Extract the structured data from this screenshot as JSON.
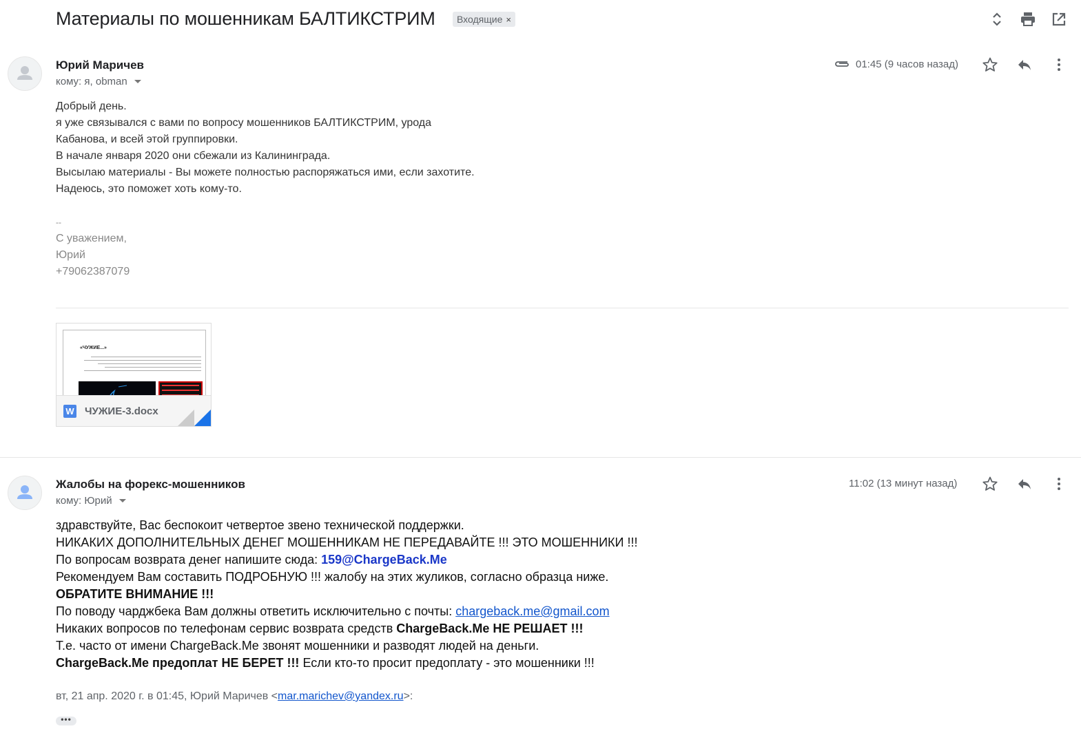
{
  "thread": {
    "subject": "Материалы по мошенникам БАЛТИКСТРИМ",
    "label": "Входящие",
    "label_close": "×"
  },
  "toolbar": {
    "expand_icon": "unfold-icon",
    "print_icon": "print-icon",
    "open_new_window_icon": "open-in-new-icon"
  },
  "message1": {
    "sender": "Юрий Маричев",
    "recipients": "кому: я, obman",
    "time": "01:45 (9 часов назад)",
    "has_attachment_icon": "paperclip-icon",
    "body_lines": [
      "Добрый день.",
      "я уже связывался с вами по вопросу мошенников БАЛТИКСТРИМ, урода",
      "Кабанова, и всей этой группировки.",
      "В начале января 2020 они сбежали из Калининграда.",
      "Высылаю материалы - Вы можете полностью распоряжаться ими, если захотите.",
      "Надеюсь, это поможет хоть кому-то."
    ],
    "signature": {
      "separator": "--",
      "line1": "С уважением,",
      "line2": "Юрий",
      "phone": "+79062387079"
    },
    "attachment": {
      "filename": "ЧУЖИЕ-3.docx",
      "type_badge": "W",
      "preview_title": "«ЧУЖИЕ...»"
    }
  },
  "message2": {
    "sender": "Жалобы на форекс-мошенников",
    "recipients": "кому: Юрий",
    "time": "11:02 (13 минут назад)",
    "lines": {
      "l1": "здравствуйте, Вас беспокоит четвертое звено технической поддержки.",
      "l2": "НИКАКИХ ДОПОЛНИТЕЛЬНЫХ ДЕНЕГ МОШЕННИКАМ НЕ ПЕРЕДАВАЙТЕ !!! ЭТО МОШЕННИКИ !!!",
      "l3_prefix": "По вопросам возврата денег напишите сюда: ",
      "l3_email": "159@ChargeBack.Me",
      "l4": "Рекомендуем Вам составить ПОДРОБНУЮ !!! жалобу на этих жуликов, согласно образца ниже.",
      "l5": "ОБРАТИТЕ ВНИМАНИЕ !!!",
      "l6_prefix": "По поводу чарджбека Вам должны ответить исключительно с почты: ",
      "l6_link": "chargeback.me@gmail.com",
      "l7_prefix": "Никаких вопросов по телефонам сервис возврата средств ",
      "l7_bold": "ChargeBack.Me НЕ РЕШАЕТ !!!",
      "l8": "Т.е. часто от имени ChargeBack.Me звонят мошенники и разводят людей на деньги.",
      "l9_bold": "ChargeBack.Me предоплат НЕ БЕРЕТ !!!",
      "l9_rest": " Если кто-то просит предоплату - это мошенники !!!"
    },
    "quote_prefix": "вт, 21 апр. 2020 г. в 01:45, Юрий Маричев <",
    "quote_email": "mar.marichev@yandex.ru",
    "quote_suffix": ">:",
    "show_trimmed": "•••"
  },
  "actions": {
    "star_icon": "star-icon",
    "reply_icon": "reply-icon",
    "more_icon": "more-vert-icon"
  }
}
